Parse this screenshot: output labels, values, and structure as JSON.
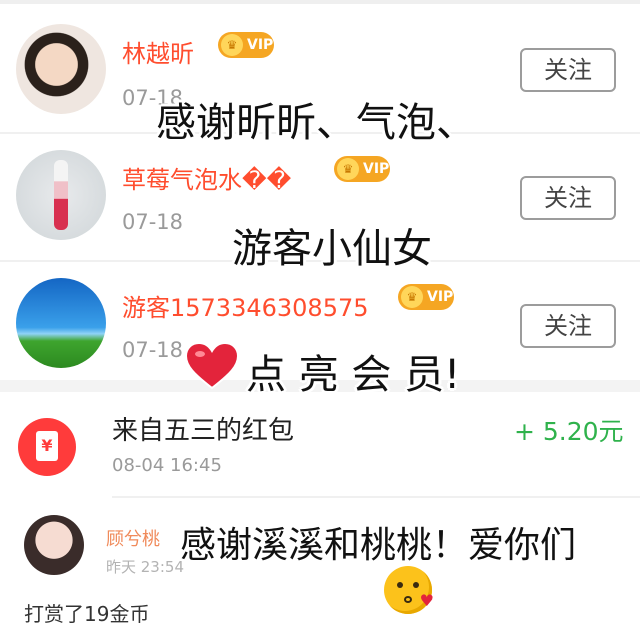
{
  "follow_list": [
    {
      "name": "林越昕",
      "date": "07-18",
      "badge": "VIP",
      "follow_label": "关注",
      "avatar": "avatar-boy-in-bed"
    },
    {
      "name": "草莓气泡水��",
      "date": "07-18",
      "badge": "VIP",
      "follow_label": "关注",
      "avatar": "avatar-strawberry-drink"
    },
    {
      "name": "游客1573346308575",
      "date": "07-18",
      "badge": "VIP",
      "follow_label": "关注",
      "avatar": "avatar-sky-grass"
    }
  ],
  "overlay": {
    "line1": "感谢昕昕、气泡、",
    "line2": "游客小仙女",
    "line3": "点 亮 会 员!",
    "line4": "感谢溪溪和桃桃！爱你们"
  },
  "red_packet": {
    "title": "来自五三的红包",
    "time": "08-04 16:45",
    "amount": "+ 5.20元",
    "icon_glyph": "¥"
  },
  "comment": {
    "name": "顾兮桃",
    "time": "昨天 23:54",
    "text": "打赏了19金币"
  },
  "colors": {
    "username": "#ff4d2e",
    "vip_badge": "#f5a623",
    "amount_green": "#2fb24c",
    "red_packet": "#ff3b3b"
  },
  "icons": [
    "vip-crown-icon",
    "heart-icon",
    "red-packet-icon",
    "kiss-emoji-icon"
  ]
}
